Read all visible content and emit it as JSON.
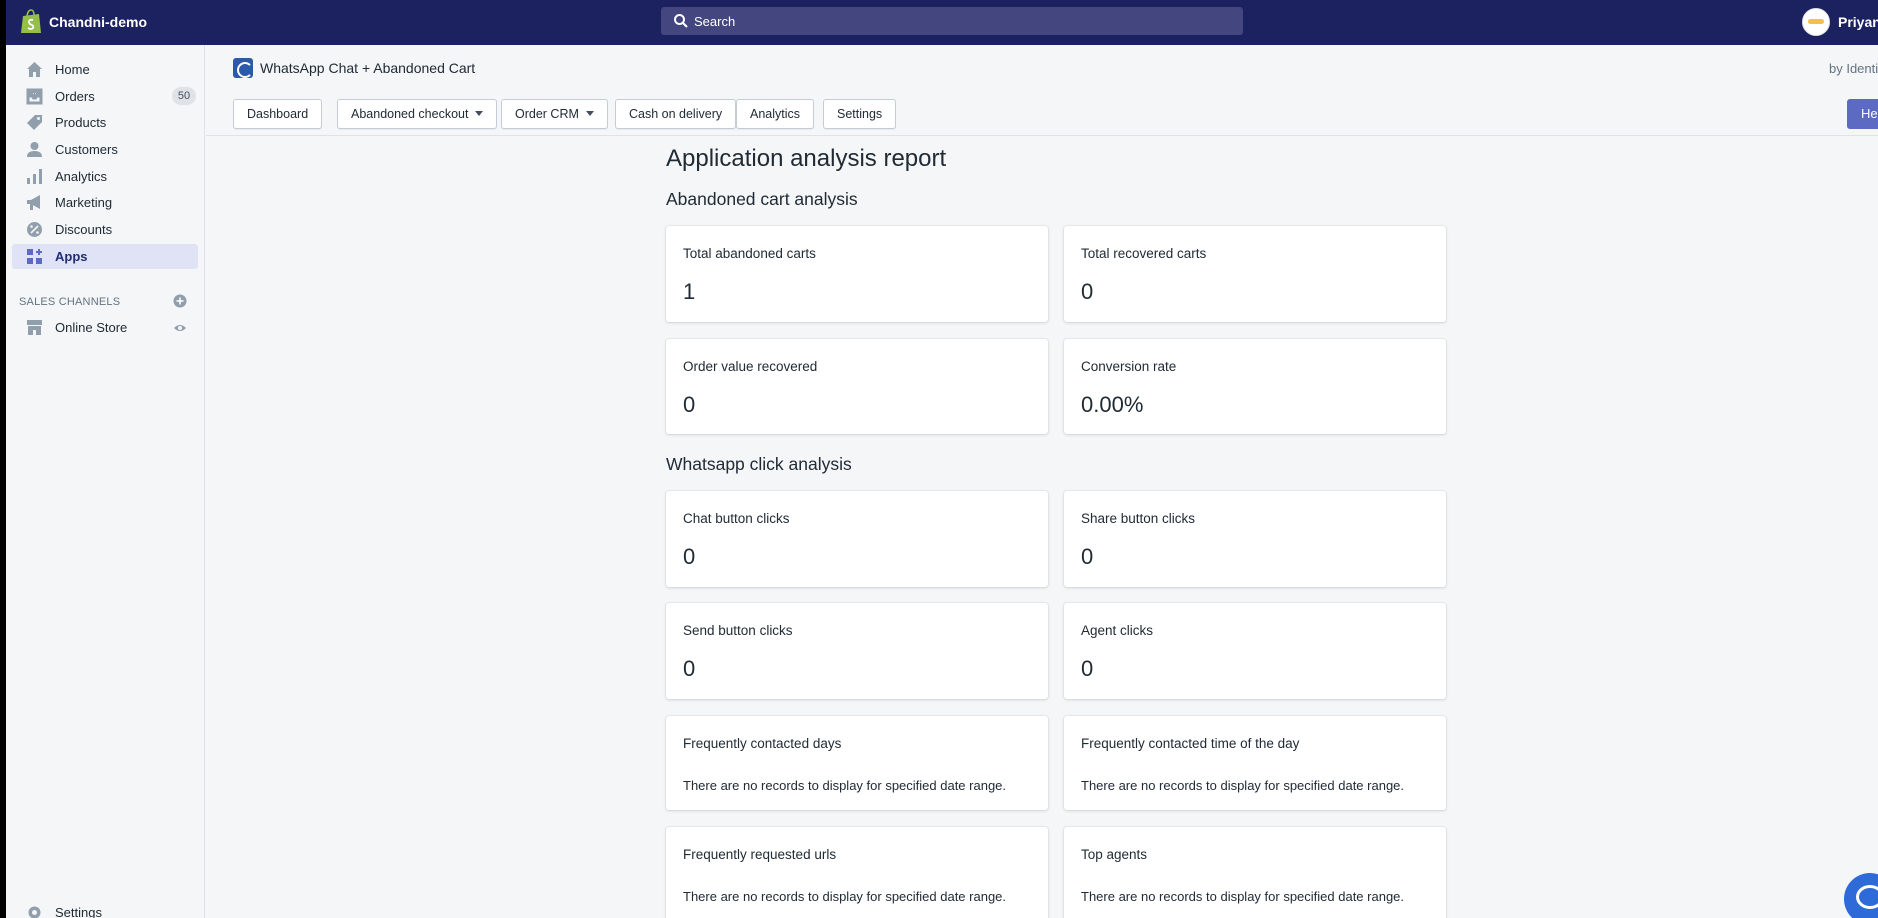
{
  "topbar": {
    "store_name": "Chandni-demo",
    "search_placeholder": "Search",
    "user_name": "Priyank",
    "bg_color": "#1c2260"
  },
  "sidebar": {
    "items": [
      {
        "label": "Home",
        "icon": "home-icon"
      },
      {
        "label": "Orders",
        "icon": "orders-icon",
        "badge": "50"
      },
      {
        "label": "Products",
        "icon": "tag-icon"
      },
      {
        "label": "Customers",
        "icon": "person-icon"
      },
      {
        "label": "Analytics",
        "icon": "bar-chart-icon"
      },
      {
        "label": "Marketing",
        "icon": "megaphone-icon"
      },
      {
        "label": "Discounts",
        "icon": "discount-icon"
      },
      {
        "label": "Apps",
        "icon": "apps-icon",
        "active": true
      }
    ],
    "sales_channels_title": "SALES CHANNELS",
    "online_store": "Online Store",
    "settings": "Settings"
  },
  "app_header": {
    "title": "WhatsApp Chat + Abandoned Cart",
    "by": "by Identix"
  },
  "tabs": [
    {
      "label": "Dashboard",
      "dropdown": false
    },
    {
      "label": "Abandoned checkout",
      "dropdown": true
    },
    {
      "label": "Order CRM",
      "dropdown": true
    },
    {
      "label": "Cash on delivery",
      "dropdown": false
    },
    {
      "label": "Analytics",
      "dropdown": false
    },
    {
      "label": "Settings",
      "dropdown": false
    }
  ],
  "help_button": "Help",
  "report": {
    "title": "Application analysis report",
    "abandoned_section": "Abandoned cart analysis",
    "whatsapp_section": "Whatsapp click analysis",
    "cards": {
      "total_abandoned": {
        "title": "Total abandoned carts",
        "value": "1"
      },
      "total_recovered": {
        "title": "Total recovered carts",
        "value": "0"
      },
      "order_value": {
        "title": "Order value recovered",
        "value": "0"
      },
      "conversion_rate": {
        "title": "Conversion rate",
        "value": "0.00%"
      },
      "chat_clicks": {
        "title": "Chat button clicks",
        "value": "0"
      },
      "share_clicks": {
        "title": "Share button clicks",
        "value": "0"
      },
      "send_clicks": {
        "title": "Send button clicks",
        "value": "0"
      },
      "agent_clicks": {
        "title": "Agent clicks",
        "value": "0"
      },
      "freq_days": {
        "title": "Frequently contacted days",
        "empty": "There are no records to display for specified date range."
      },
      "freq_time": {
        "title": "Frequently contacted time of the day",
        "empty": "There are no records to display for specified date range."
      },
      "freq_urls": {
        "title": "Frequently requested urls",
        "empty": "There are no records to display for specified date range."
      },
      "top_agents": {
        "title": "Top agents",
        "empty": "There are no records to display for specified date range."
      }
    }
  }
}
